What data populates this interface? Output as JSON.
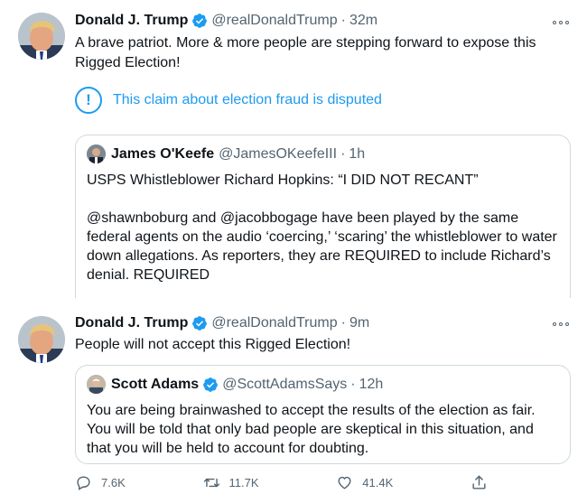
{
  "tweet1": {
    "author_name": "Donald J. Trump",
    "author_handle": "@realDonaldTrump",
    "time": "32m",
    "text": "A brave patriot. More & more people are stepping forward to expose this Rigged Election!",
    "notice": "This claim about election fraud is disputed",
    "quote": {
      "author_name": "James O'Keefe",
      "author_handle": "@JamesOKeefeIII",
      "time": "1h",
      "paragraph1": "USPS Whistleblower Richard Hopkins: “I DID NOT RECANT”",
      "paragraph2": "@shawnboburg and @jacobbogage have been played by the same federal agents on the audio ‘coercing,’ ‘scaring’ the whistleblower to water down allegations.  As reporters, they are REQUIRED to include Richard’s denial. REQUIRED"
    }
  },
  "tweet2": {
    "author_name": "Donald J. Trump",
    "author_handle": "@realDonaldTrump",
    "time": "9m",
    "text": "People will not accept this Rigged Election!",
    "quote": {
      "author_name": "Scott Adams",
      "author_handle": "@ScottAdamsSays",
      "time": "12h",
      "text": "You are being brainwashed to accept the results of the election as fair. You will be told that only bad people are skeptical in this situation, and that you will be held to account for doubting."
    },
    "actions": {
      "replies": "7.6K",
      "retweets": "11.7K",
      "likes": "41.4K"
    }
  },
  "separator": "·",
  "icons": [
    "verified-badge-icon",
    "more-options-icon",
    "info-icon",
    "reply-icon",
    "retweet-icon",
    "like-icon",
    "share-icon"
  ],
  "colors": {
    "accent": "#1d9bf0",
    "secondary_text": "#536471",
    "border": "#cfd9de"
  }
}
